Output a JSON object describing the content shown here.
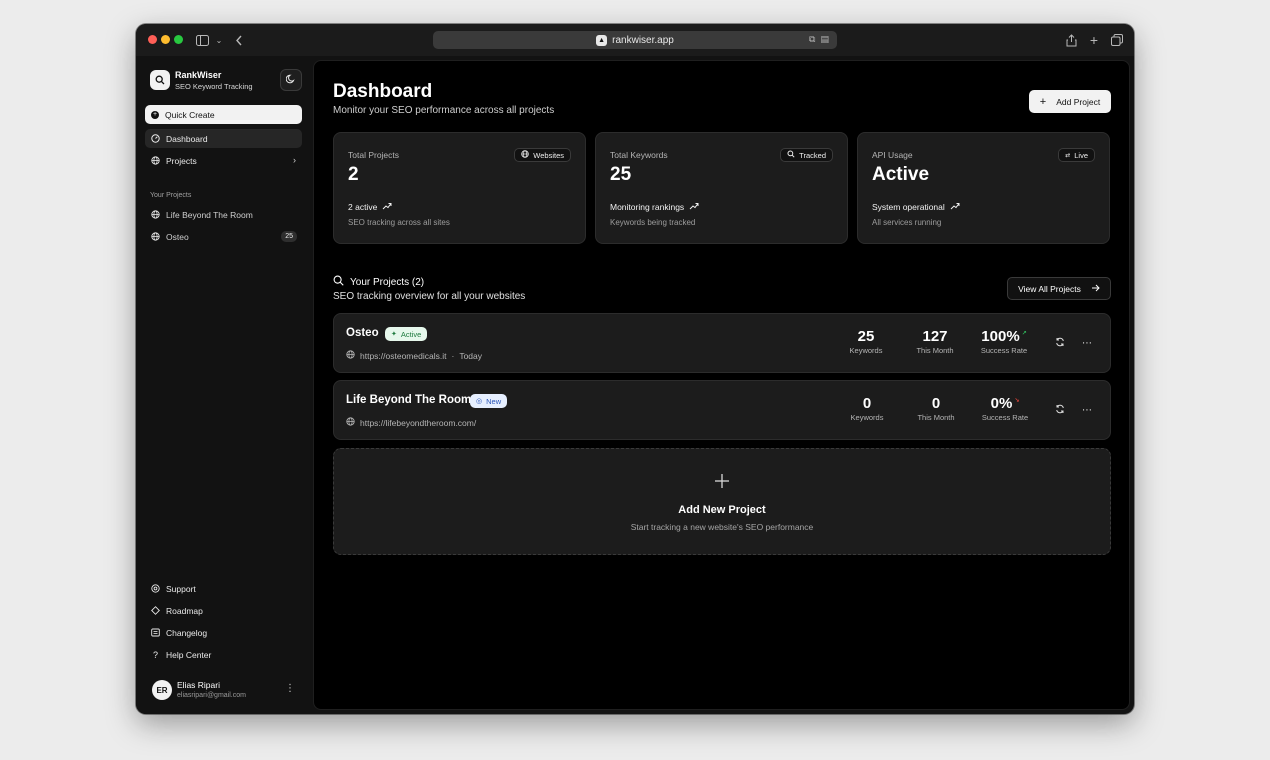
{
  "browser": {
    "url": "rankwiser.app",
    "colors": {
      "close": "#ff5f57",
      "minimize": "#febc2e",
      "zoom": "#28c840"
    }
  },
  "sidebar": {
    "brand": {
      "name": "RankWiser",
      "subtitle": "SEO Keyword Tracking"
    },
    "quick_create": "Quick Create",
    "nav": [
      {
        "label": "Dashboard",
        "icon": "dashboard-icon",
        "active": true
      },
      {
        "label": "Projects",
        "icon": "globe-icon",
        "active": false
      }
    ],
    "section_label": "Your Projects",
    "projects": [
      {
        "label": "Life Beyond The Room",
        "count": ""
      },
      {
        "label": "Osteo",
        "count": "25"
      }
    ],
    "footer_nav": [
      {
        "label": "Support",
        "icon": "support-icon"
      },
      {
        "label": "Roadmap",
        "icon": "roadmap-icon"
      },
      {
        "label": "Changelog",
        "icon": "changelog-icon"
      },
      {
        "label": "Help Center",
        "icon": "help-icon"
      }
    ],
    "user": {
      "initials": "ER",
      "name": "Elias Ripari",
      "email": "eliasripari@gmail.com"
    }
  },
  "main": {
    "title": "Dashboard",
    "subtitle": "Monitor your SEO performance across all projects",
    "add_project": "Add Project",
    "cards": [
      {
        "label": "Total Projects",
        "value": "2",
        "badge": "Websites",
        "badge_icon": "globe-icon",
        "trend": "2 active",
        "foot": "SEO tracking across all sites"
      },
      {
        "label": "Total Keywords",
        "value": "25",
        "badge": "Tracked",
        "badge_icon": "search-icon",
        "trend": "Monitoring rankings",
        "foot": "Keywords being tracked"
      },
      {
        "label": "API Usage",
        "value": "Active",
        "badge": "Live",
        "badge_icon": "api-icon",
        "trend": "System operational",
        "foot": "All services running"
      }
    ],
    "projects_section": {
      "title": "Your Projects (2)",
      "subtitle": "SEO tracking overview for all your websites",
      "view_all": "View All Projects"
    },
    "project_rows": [
      {
        "name": "Osteo",
        "status": "Active",
        "url": "https://osteomedicals.it",
        "separator": "·",
        "updated": "Today",
        "keywords": "25",
        "keywords_label": "Keywords",
        "this_month": "127",
        "this_month_label": "This Month",
        "success": "100%",
        "success_label": "Success Rate",
        "trend_color": "#2fb35a"
      },
      {
        "name": "Life Beyond The Room",
        "status": "New",
        "url": "https://lifebeyondtheroom.com/",
        "separator": "",
        "updated": "",
        "keywords": "0",
        "keywords_label": "Keywords",
        "this_month": "0",
        "this_month_label": "This Month",
        "success": "0%",
        "success_label": "Success Rate",
        "trend_color": "#e0453a"
      }
    ],
    "add_new": {
      "title": "Add New Project",
      "subtitle": "Start tracking a new website's SEO performance"
    }
  }
}
